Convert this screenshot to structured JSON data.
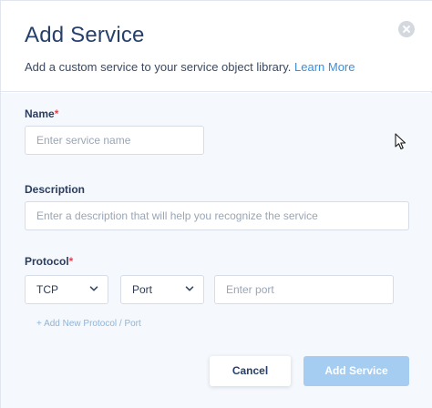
{
  "modal": {
    "title": "Add Service",
    "subtitle": "Add a custom service to your service object library.",
    "learn_more": "Learn More"
  },
  "form": {
    "name": {
      "label": "Name",
      "required_mark": "*",
      "placeholder": "Enter service name",
      "value": ""
    },
    "description": {
      "label": "Description",
      "placeholder": "Enter a description that will help you recognize the service",
      "value": ""
    },
    "protocol": {
      "label": "Protocol",
      "required_mark": "*",
      "protocol_value": "TCP",
      "port_type_value": "Port",
      "port_placeholder": "Enter port",
      "port_value": ""
    },
    "add_protocol_link": "+ Add New Protocol / Port"
  },
  "actions": {
    "cancel_label": "Cancel",
    "submit_label": "Add Service"
  },
  "colors": {
    "title": "#27406b",
    "link": "#3b8fd9",
    "required": "#e0454f",
    "primary_disabled": "#a5cdf2",
    "body_bg": "#f5f8fc"
  },
  "icons": {
    "close": "close-icon",
    "dropdown": "chevron-down-icon",
    "cursor": "mouse-cursor-icon"
  }
}
